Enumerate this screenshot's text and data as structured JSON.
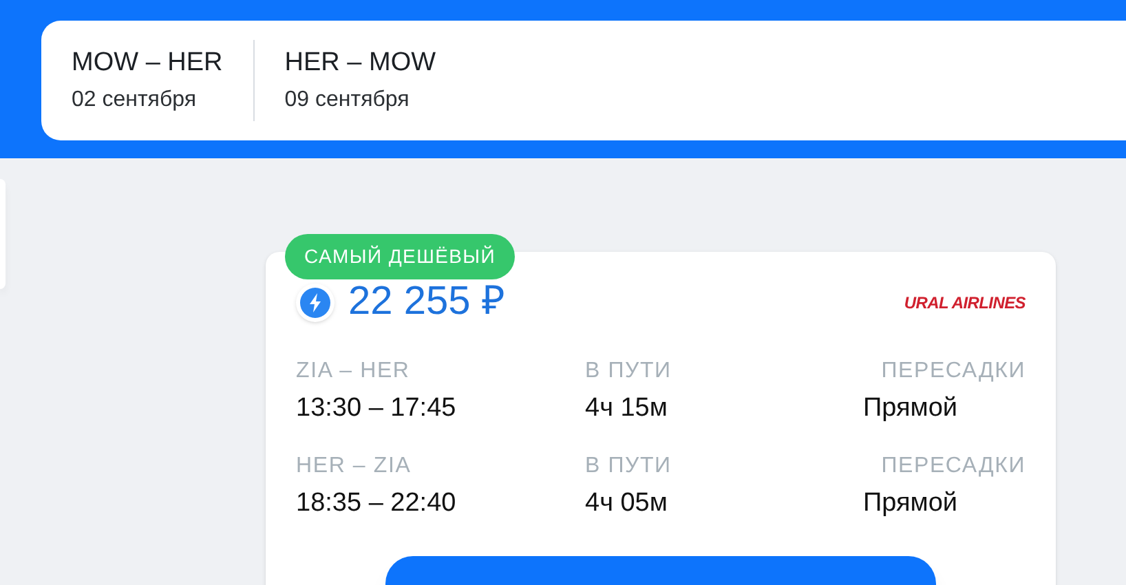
{
  "trip_tabs": [
    {
      "route": "MOW – HER",
      "date": "02 сентября"
    },
    {
      "route": "HER – MOW",
      "date": "09 сентября"
    }
  ],
  "ticket": {
    "badge": "САМЫЙ ДЕШЁВЫЙ",
    "price": "22 255 ₽",
    "airline": "URAL AIRLINES",
    "segments": [
      {
        "route": "ZIA – HER",
        "times": "13:30 – 17:45",
        "duration_label": "В ПУТИ",
        "duration": "4ч 15м",
        "stops_label": "ПЕРЕСАДКИ",
        "stops": "Прямой"
      },
      {
        "route": "HER – ZIA",
        "times": "18:35 – 22:40",
        "duration_label": "В ПУТИ",
        "duration": "4ч 05м",
        "stops_label": "ПЕРЕСАДКИ",
        "stops": "Прямой"
      }
    ]
  }
}
